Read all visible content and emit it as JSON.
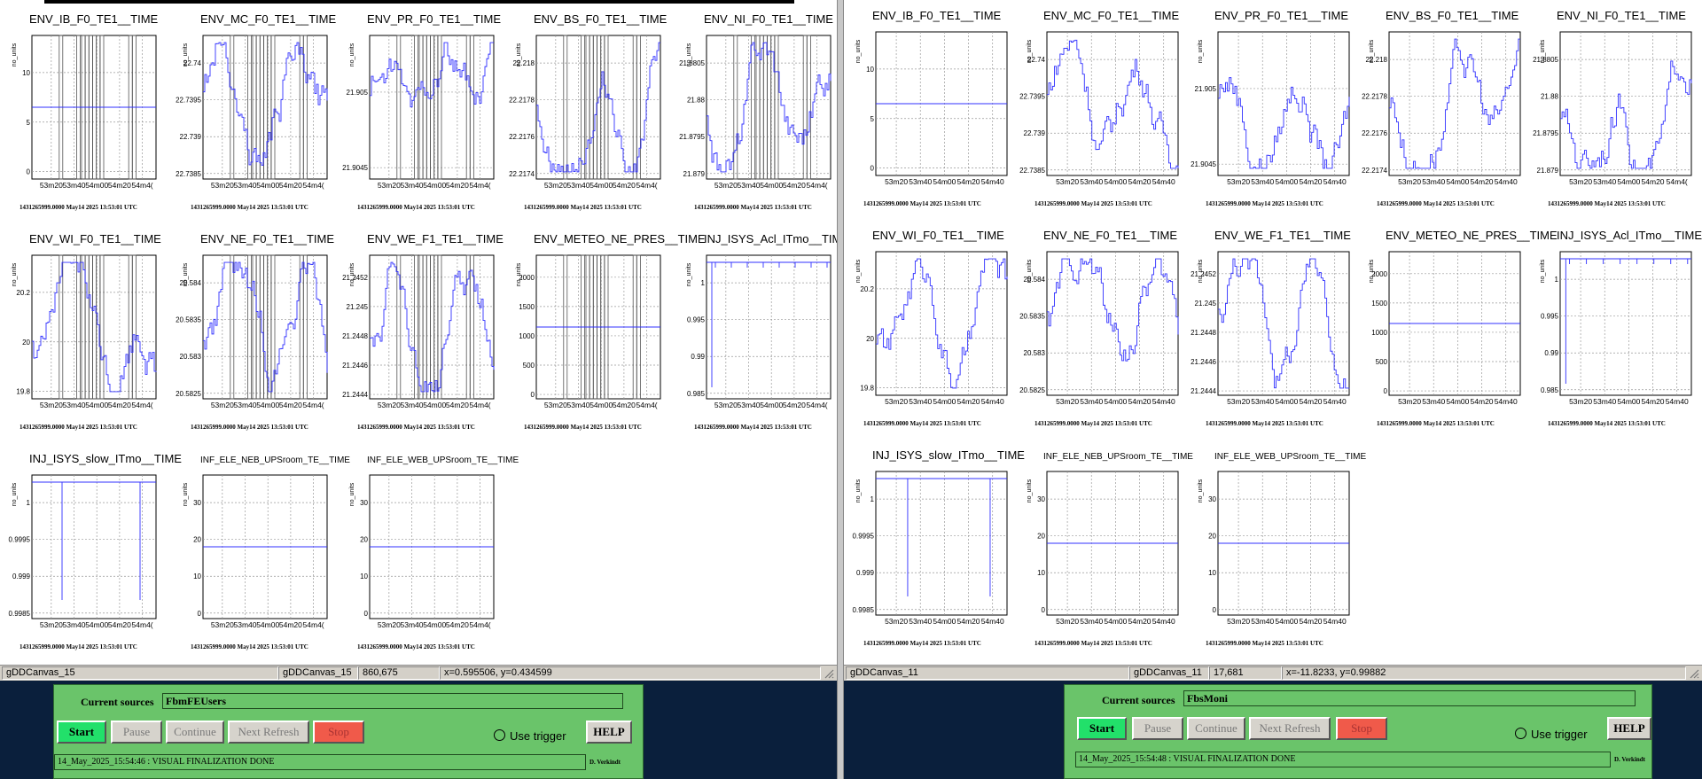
{
  "common": {
    "axis_unit": "no_units",
    "x_ticks": [
      "53m20",
      "53m40",
      "54m00",
      "54m20",
      "54m40"
    ],
    "x_ticks_cut": [
      "53m20",
      "53m40",
      "54m00",
      "54m20",
      "54m4("
    ],
    "timestamp": "1431265999.0000 May14 2025 13:53:01 UTC"
  },
  "left_pane": {
    "plots": [
      {
        "title": "ENV_IB_F0_TE1__TIME",
        "yticks": [
          "0",
          "5",
          "10"
        ],
        "series": "flat",
        "bands": true
      },
      {
        "title": "ENV_MC_F0_TE1__TIME",
        "yticks": [
          "22.7385",
          "22.739",
          "22.7395",
          "22.74"
        ],
        "series": "noise",
        "bands": true
      },
      {
        "title": "ENV_PR_F0_TE1__TIME",
        "yticks": [
          "21.9045",
          "21.905"
        ],
        "series": "noise",
        "bands": true
      },
      {
        "title": "ENV_BS_F0_TE1__TIME",
        "yticks": [
          "22.2174",
          "22.2176",
          "22.2178",
          "22.218"
        ],
        "series": "noise",
        "bands": true
      },
      {
        "title": "ENV_NI_F0_TE1__TIME",
        "yticks": [
          "21.879",
          "21.8795",
          "21.88",
          "21.8805"
        ],
        "series": "noise",
        "bands": true
      },
      {
        "title": "ENV_WI_F0_TE1__TIME",
        "yticks": [
          "19.8",
          "20",
          "20.2"
        ],
        "series": "noise",
        "bands": true
      },
      {
        "title": "ENV_NE_F0_TE1__TIME",
        "yticks": [
          "20.5825",
          "20.583",
          "20.5835",
          "20.584"
        ],
        "series": "noise",
        "bands": true
      },
      {
        "title": "ENV_WE_F1_TE1__TIME",
        "yticks": [
          "21.2444",
          "21.2446",
          "21.2448",
          "21.245",
          "21.2452"
        ],
        "series": "noise",
        "bands": true
      },
      {
        "title": "ENV_METEO_NE_PRES__TIME",
        "yticks": [
          "0",
          "500",
          "1000",
          "1500",
          "2000"
        ],
        "series": "flat",
        "bands": true
      },
      {
        "title": "INJ_ISYS_Acl_ITmo__TIME",
        "yticks": [
          "0.985",
          "0.99",
          "0.995",
          "1"
        ],
        "series": "ones",
        "bands": false
      },
      {
        "title": "INJ_ISYS_slow_ITmo__TIME",
        "yticks": [
          "0.9985",
          "0.999",
          "0.9995",
          "1"
        ],
        "series": "ones2",
        "bands": false
      },
      {
        "title": "INF_ELE_NEB_UPSroom_TE__TIME",
        "yticks": [
          "0",
          "10",
          "20",
          "30"
        ],
        "series": "flat",
        "bands": false
      },
      {
        "title": "INF_ELE_WEB_UPSroom_TE__TIME",
        "yticks": [
          "0",
          "10",
          "20",
          "30"
        ],
        "series": "flat",
        "bands": false
      }
    ],
    "status": {
      "canvas_name": "gDDCanvas_15",
      "canvas_name2": "gDDCanvas_15",
      "pixel": "860,675",
      "coords": "x=0.595506, y=0.434599"
    },
    "control": {
      "sources_label": "Current sources",
      "sources_value": "FbmFEUsers",
      "start": "Start",
      "pause": "Pause",
      "continue": "Continue",
      "next_refresh": "Next Refresh",
      "stop": "Stop",
      "trigger": "Use trigger",
      "help": "HELP",
      "message": "14_May_2025_15:54:46 : VISUAL FINALIZATION DONE",
      "author": "D. Verkindt"
    }
  },
  "right_pane": {
    "plots": [
      {
        "title": "ENV_IB_F0_TE1__TIME",
        "yticks": [
          "0",
          "5",
          "10"
        ],
        "series": "flat",
        "bands": false
      },
      {
        "title": "ENV_MC_F0_TE1__TIME",
        "yticks": [
          "22.7385",
          "22.739",
          "22.7395",
          "22.74"
        ],
        "series": "noise",
        "bands": false
      },
      {
        "title": "ENV_PR_F0_TE1__TIME",
        "yticks": [
          "21.9045",
          "21.905"
        ],
        "series": "noise",
        "bands": false
      },
      {
        "title": "ENV_BS_F0_TE1__TIME",
        "yticks": [
          "22.2174",
          "22.2176",
          "22.2178",
          "22.218"
        ],
        "series": "noise",
        "bands": false
      },
      {
        "title": "ENV_NI_F0_TE1__TIME",
        "yticks": [
          "21.879",
          "21.8795",
          "21.88",
          "21.8805"
        ],
        "series": "noise",
        "bands": false
      },
      {
        "title": "ENV_WI_F0_TE1__TIME",
        "yticks": [
          "19.8",
          "20",
          "20.2"
        ],
        "series": "noise",
        "bands": false
      },
      {
        "title": "ENV_NE_F0_TE1__TIME",
        "yticks": [
          "20.5825",
          "20.583",
          "20.5835",
          "20.584"
        ],
        "series": "noise",
        "bands": false
      },
      {
        "title": "ENV_WE_F1_TE1__TIME",
        "yticks": [
          "21.2444",
          "21.2446",
          "21.2448",
          "21.245",
          "21.2452"
        ],
        "series": "noise",
        "bands": false
      },
      {
        "title": "ENV_METEO_NE_PRES__TIME",
        "yticks": [
          "0",
          "500",
          "1000",
          "1500",
          "2000"
        ],
        "series": "flat",
        "bands": false
      },
      {
        "title": "INJ_ISYS_Acl_ITmo__TIME",
        "yticks": [
          "0.985",
          "0.99",
          "0.995",
          "1"
        ],
        "series": "ones",
        "bands": false
      },
      {
        "title": "INJ_ISYS_slow_ITmo__TIME",
        "yticks": [
          "0.9985",
          "0.999",
          "0.9995",
          "1"
        ],
        "series": "ones2",
        "bands": false
      },
      {
        "title": "INF_ELE_NEB_UPSroom_TE__TIME",
        "yticks": [
          "0",
          "10",
          "20",
          "30"
        ],
        "series": "flat",
        "bands": false
      },
      {
        "title": "INF_ELE_WEB_UPSroom_TE__TIME",
        "yticks": [
          "0",
          "10",
          "20",
          "30"
        ],
        "series": "flat",
        "bands": false
      }
    ],
    "status": {
      "canvas_name": "gDDCanvas_11",
      "canvas_name2": "gDDCanvas_11",
      "pixel": "17,681",
      "coords": "x=-11.8233, y=0.99882"
    },
    "control": {
      "sources_label": "Current sources",
      "sources_value": "FbsMoni",
      "start": "Start",
      "pause": "Pause",
      "continue": "Continue",
      "next_refresh": "Next Refresh",
      "stop": "Stop",
      "trigger": "Use trigger",
      "help": "HELP",
      "message": "14_May_2025_15:54:48 : VISUAL FINALIZATION DONE",
      "author": "D. Verkindt"
    }
  },
  "colors": {
    "trace": "#3030ff",
    "grid": "#999999",
    "panel": "#6ac46a",
    "start": "#22e06a",
    "stop": "#f05a4a",
    "band": "#555555"
  }
}
